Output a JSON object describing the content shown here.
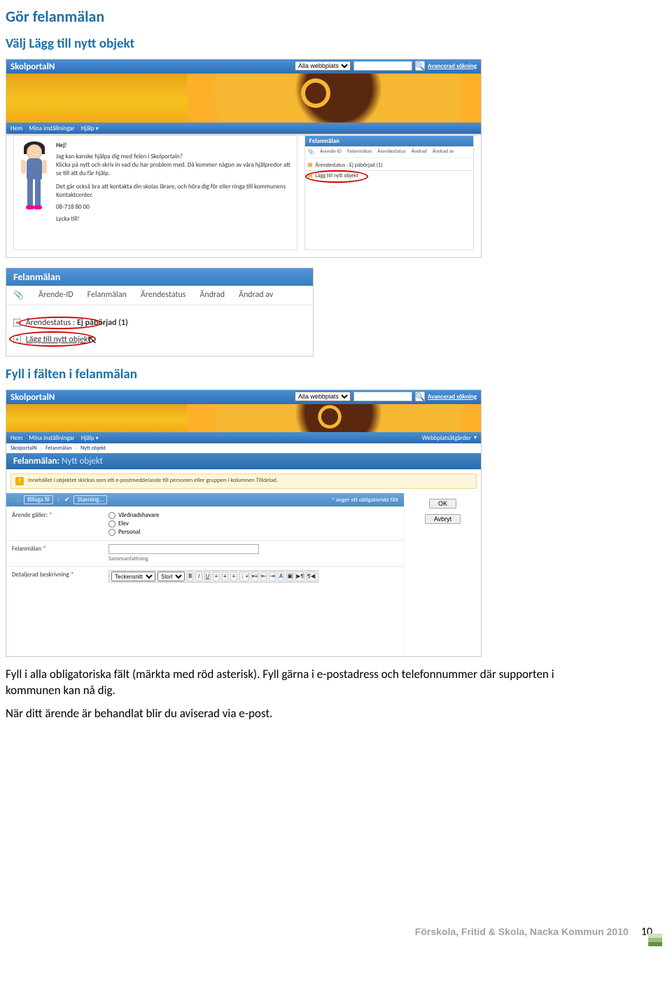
{
  "heading": "Gör felanmälan",
  "sub1": "Välj Lägg till nytt objekt",
  "sub2": "Fyll i fälten i felanmälan",
  "para": "Fyll i alla obligatoriska fält (märkta med röd asterisk). Fyll gärna i e-postadress och telefonnummer där supporten i kommunen kan nå dig.",
  "para2": "När ditt ärende är behandlat blir du aviserad via e-post.",
  "site_name": "SkolportalN",
  "search": {
    "all": "Alla webbplatser",
    "placeholder": "",
    "adv": "Avancerad sökning"
  },
  "menu": {
    "hem": "Hem",
    "mina": "Mina inställningar",
    "hjalp": "Hjälp",
    "webbplats": "Webbplatsåtgärder"
  },
  "leftcard": {
    "hej": "Hej!",
    "l1": "Jag kan kanske hjälpa dig med felen i Skolportaln?",
    "l2": "Klicka på nytt och skriv in vad du har problem med. Då kommer någon av våra hjälpredor att se till att du får hjälp.",
    "l3": "Det går också bra att kontakta din skolas lärare, och höra dig för eller ringa till kommunens Kontaktcenter.",
    "phone": "08-718 80 00",
    "sign": "Lycka till!"
  },
  "felan": {
    "title": "Felanmälan",
    "cols": {
      "att": "📎",
      "id": "Ärende-ID",
      "fel": "Felanmälan",
      "status": "Ärendestatus",
      "andrad": "Ändrad",
      "av": "Ändrad av"
    },
    "group_prefix": "Ärendestatus",
    "group_label": "Ej påbörjad (1)",
    "add_label": "Lägg till nytt objekt"
  },
  "breadcrumb": {
    "a": "SkolportalN",
    "b": "Felanmälan",
    "c": "Nytt objekt"
  },
  "pagetitle": {
    "main": "Felanmälan:",
    "suffix": " Nytt objekt"
  },
  "notice": "Innehållet i objektet skickas som ett e-postmeddelande till personen eller gruppen i kolumnen Tilldelad.",
  "buttons": {
    "ok": "OK",
    "cancel": "Avbryt"
  },
  "toolbar": {
    "attach": "Bifoga fil",
    "spell": "Stavning...",
    "note": "* anger ett obligatoriskt fält"
  },
  "form": {
    "row1": {
      "label": "Ärende gäller:",
      "req": "*",
      "opt1": "Vårdnadshavare",
      "opt2": "Elev",
      "opt3": "Personal"
    },
    "row2": {
      "label": "Felanmälan",
      "req": "*",
      "summary": "Sammanfattning"
    },
    "row3": {
      "label": "Detaljerad beskrivning",
      "req": "*"
    }
  },
  "rich": {
    "font": "Teckensnitt",
    "size": "Storl"
  },
  "footer": {
    "text": "Förskola, Fritid & Skola, Nacka Kommun 2010",
    "page": "10"
  }
}
